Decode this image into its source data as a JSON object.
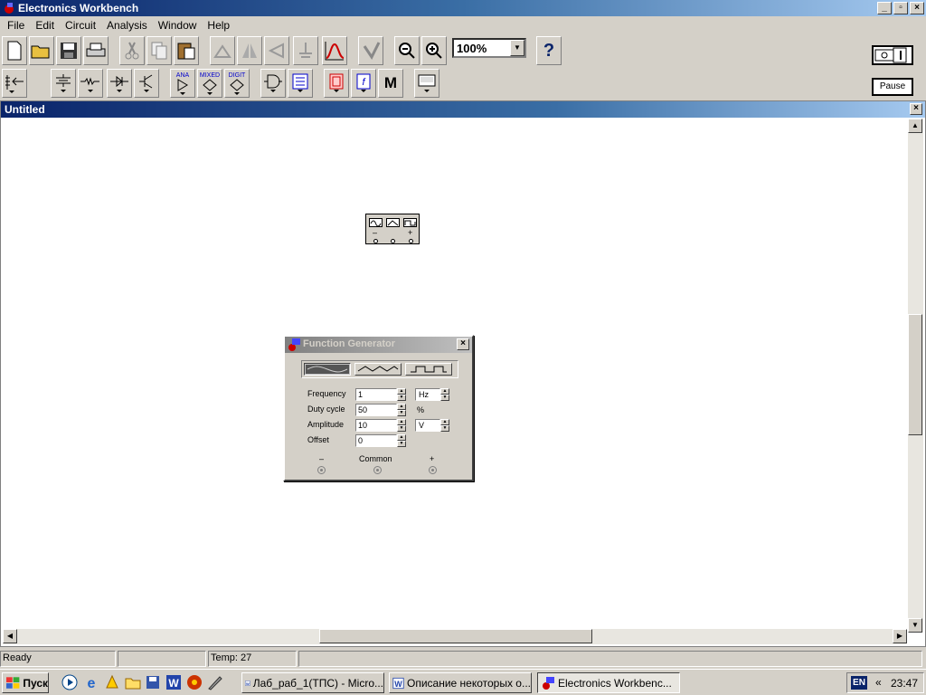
{
  "app": {
    "title": "Electronics Workbench"
  },
  "menu": {
    "items": [
      "File",
      "Edit",
      "Circuit",
      "Analysis",
      "Window",
      "Help"
    ]
  },
  "toolbar": {
    "zoom_value": "100%",
    "help_label": "?",
    "pause_label": "Pause",
    "bin_labels": {
      "analog": "ANA",
      "mixed": "MIXED",
      "digital": "DIGIT",
      "misc": "M"
    }
  },
  "document": {
    "title": "Untitled"
  },
  "function_generator_dialog": {
    "title": "Function Generator",
    "frequency_label": "Frequency",
    "frequency_value": "1",
    "frequency_unit": "Hz",
    "duty_cycle_label": "Duty cycle",
    "duty_cycle_value": "50",
    "duty_cycle_unit": "%",
    "amplitude_label": "Amplitude",
    "amplitude_value": "10",
    "amplitude_unit": "V",
    "offset_label": "Offset",
    "offset_value": "0",
    "terminal_minus": "–",
    "terminal_common": "Common",
    "terminal_plus": "+",
    "selected_waveform": "sine"
  },
  "component_icon": {
    "minus": "–",
    "plus": "+"
  },
  "status": {
    "state": "Ready",
    "empty": "",
    "temp": "Temp:  27"
  },
  "taskbar": {
    "start_label": "Пуск",
    "tasks": [
      "Лаб_раб_1(ТПС) - Micro...",
      "Описание некоторых о...",
      "Electronics Workbenc..."
    ],
    "lang": "EN",
    "tray_arrow": "«",
    "clock": "23:47"
  },
  "colors": {
    "titlebar": "#0a246a",
    "face": "#d4d0c8",
    "canvas": "#ffffff"
  }
}
